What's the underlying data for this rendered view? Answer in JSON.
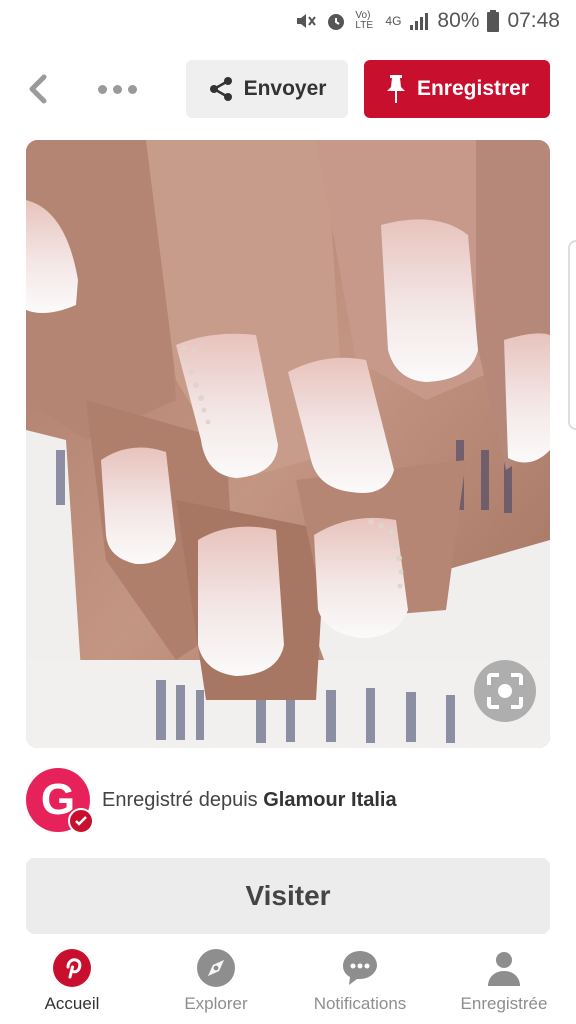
{
  "status_bar": {
    "network_label": "Vo) LTE",
    "signal_label": "4G",
    "battery": "80%",
    "time": "07:48"
  },
  "toolbar": {
    "send_label": "Envoyer",
    "save_label": "Enregistrer"
  },
  "pin": {
    "image_description_icon": "nail-photo",
    "lens_icon": "visual-search-icon"
  },
  "source": {
    "avatar_letter": "G",
    "prefix": "Enregistré depuis",
    "name": "Glamour Italia"
  },
  "visit": {
    "label": "Visiter"
  },
  "bottom_nav": {
    "items": [
      {
        "label": "Accueil",
        "icon": "pinterest-icon",
        "active": true
      },
      {
        "label": "Explorer",
        "icon": "compass-icon",
        "active": false
      },
      {
        "label": "Notifications",
        "icon": "chat-bubble-icon",
        "active": false
      },
      {
        "label": "Enregistrée",
        "icon": "person-icon",
        "active": false
      }
    ]
  },
  "colors": {
    "brand_red": "#c8102e",
    "avatar_pink": "#e7225b"
  }
}
